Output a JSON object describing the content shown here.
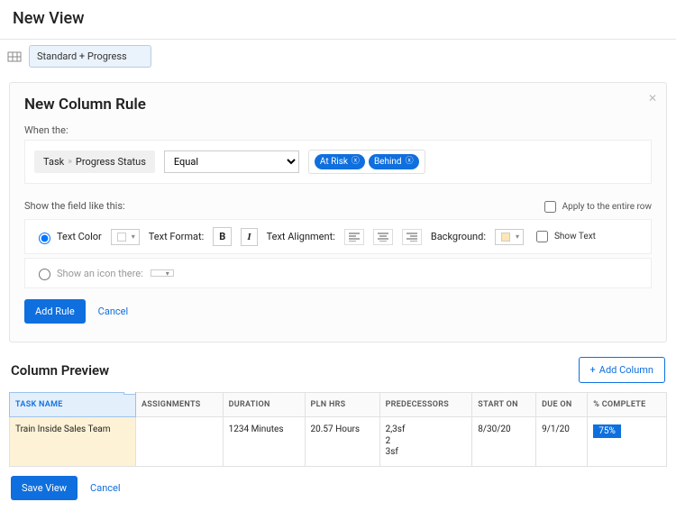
{
  "page": {
    "title": "New View"
  },
  "toolbar": {
    "view_name": "Standard + Progress"
  },
  "rule_panel": {
    "title": "New Column Rule",
    "when_label": "When the:",
    "field_path": [
      "Task",
      "Progress Status"
    ],
    "operator": "Equal",
    "tags": [
      "At Risk",
      "Behind"
    ],
    "show_label": "Show the field like this:",
    "apply_row_label": "Apply to the entire row",
    "text_color_label": "Text Color",
    "text_format_label": "Text Format:",
    "text_align_label": "Text Alignment:",
    "background_label": "Background:",
    "show_text_label": "Show Text",
    "icon_row_label": "Show an icon there:",
    "add_rule_label": "Add Rule",
    "cancel_label": "Cancel"
  },
  "preview": {
    "title": "Column Preview",
    "add_column_label": "Add Column",
    "columns": [
      "TASK NAME",
      "ASSIGNMENTS",
      "DURATION",
      "PLN HRS",
      "PREDECESSORS",
      "START ON",
      "DUE ON",
      "% COMPLETE"
    ],
    "row": {
      "task_name": "Train Inside Sales Team",
      "assignments": "",
      "duration": "1234 Minutes",
      "pln_hrs": "20.57 Hours",
      "predecessors": [
        "2,3sf",
        "2",
        "3sf"
      ],
      "start_on": "8/30/20",
      "due_on": "9/1/20",
      "pct_complete": "75%"
    }
  },
  "footer": {
    "save_label": "Save View",
    "cancel_label": "Cancel"
  },
  "colors": {
    "primary": "#0f6fde",
    "bg_swatch": "#ffe7b5"
  }
}
